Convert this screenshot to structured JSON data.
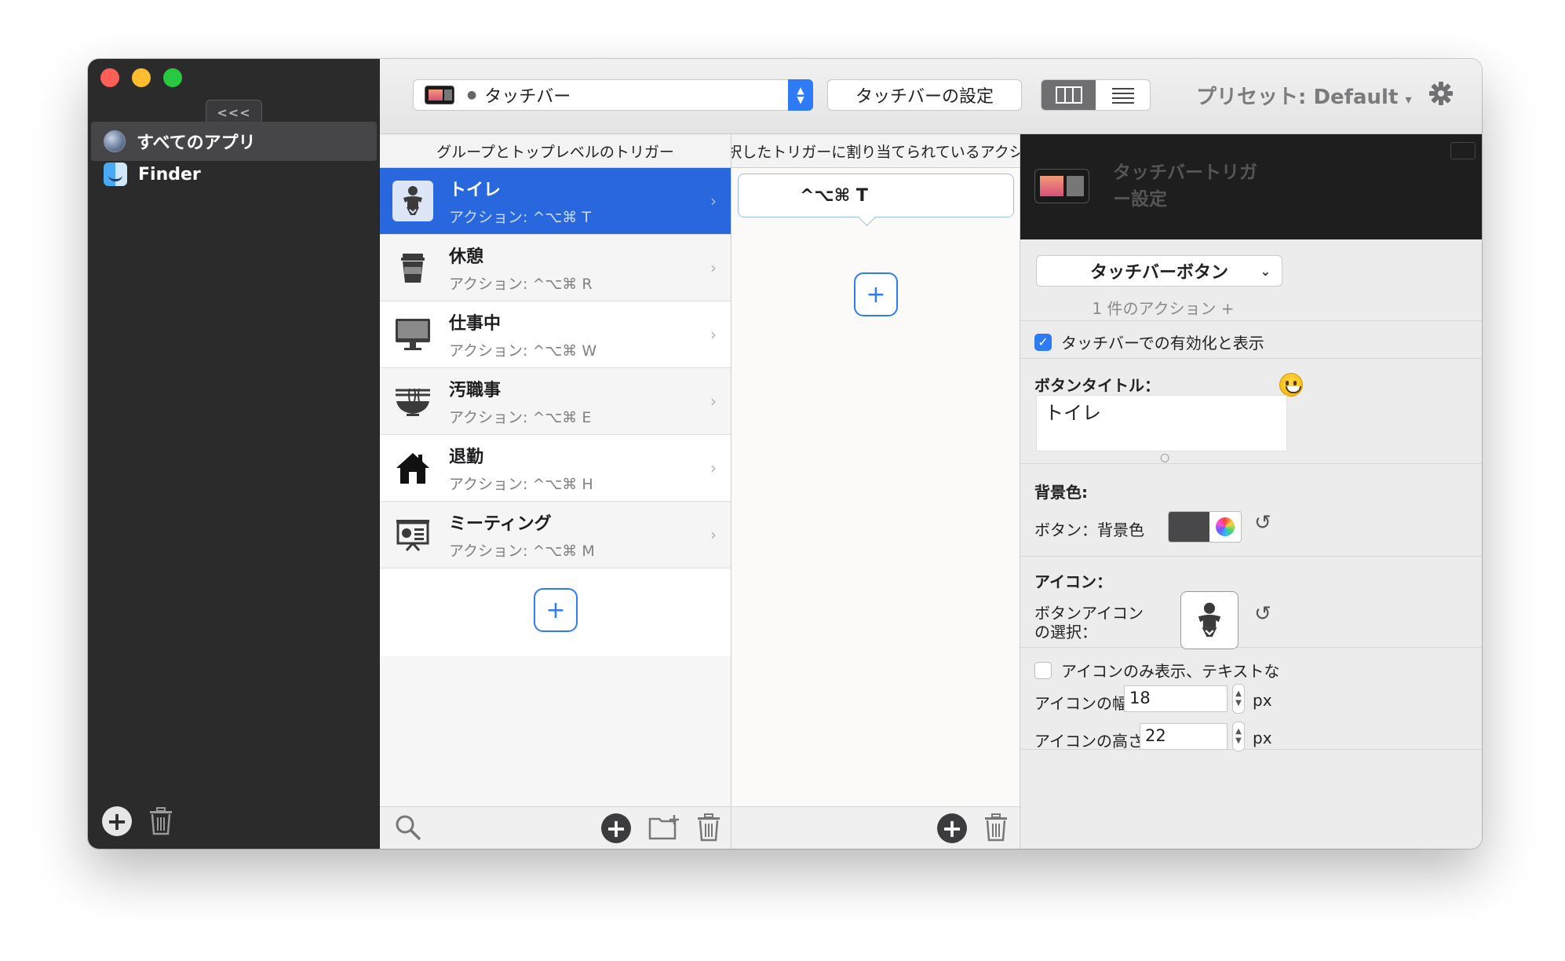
{
  "sidebar": {
    "collapse_label": "<<<",
    "items": [
      {
        "label": "すべてのアプリ",
        "icon": "globe-icon"
      },
      {
        "label": "Finder",
        "icon": "finder-icon"
      }
    ]
  },
  "toolbar": {
    "select_value": "タッチバー",
    "settings_button": "タッチバーの設定",
    "preset_label": "プリセット: Default"
  },
  "triggers": {
    "header": "グループとトップレベルのトリガー",
    "items": [
      {
        "name": "トイレ",
        "action": "アクション: ^⌥⌘ T",
        "icon": "baby-icon"
      },
      {
        "name": "休憩",
        "action": "アクション: ^⌥⌘ R",
        "icon": "coffee-cup-icon"
      },
      {
        "name": "仕事中",
        "action": "アクション: ^⌥⌘ W",
        "icon": "monitor-icon"
      },
      {
        "name": "汚職事",
        "action": "アクション: ^⌥⌘ E",
        "icon": "noodle-bowl-icon"
      },
      {
        "name": "退勤",
        "action": "アクション: ^⌥⌘ H",
        "icon": "home-icon"
      },
      {
        "name": "ミーティング",
        "action": "アクション: ^⌥⌘ M",
        "icon": "presentation-icon"
      }
    ],
    "add_label": "+"
  },
  "actions": {
    "header": "選択したトリガーに割り当てられているアクシ…",
    "items": [
      {
        "shortcut": "^⌥⌘ T"
      }
    ],
    "add_label": "+"
  },
  "inspector": {
    "title": "タッチバートリガー設定",
    "type_dropdown": "タッチバーボタン",
    "action_count": "1 件のアクション +",
    "enable_label": "タッチバーでの有効化と表示",
    "button_title_label": "ボタンタイトル：",
    "button_title_value": "トイレ",
    "bg_section_label": "背景色:",
    "bg_label": "ボタン：背景色",
    "bg_color": "#48484a",
    "icon_section_label": "アイコン：",
    "icon_select_label_1": "ボタンアイコン",
    "icon_select_label_2": "の選択：",
    "icon_only_label": "アイコンのみ表示、テキストな",
    "icon_width_label": "アイコンの幅",
    "icon_width_value": "18",
    "icon_height_label": "アイコンの高さ",
    "icon_height_value": "22",
    "unit": "px"
  },
  "colors": {
    "accent": "#2867dd",
    "sidebar_bg": "#2b2b2c"
  }
}
